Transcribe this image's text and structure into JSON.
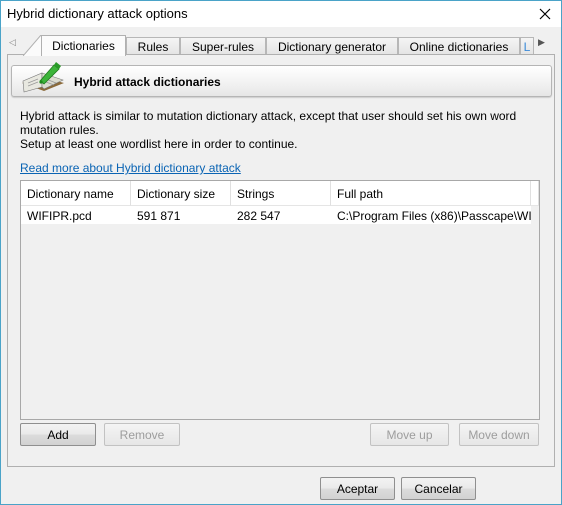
{
  "window": {
    "title": "Hybrid dictionary attack options",
    "close_icon": "close-icon"
  },
  "tabs": [
    {
      "label": "Dictionaries",
      "active": true
    },
    {
      "label": "Rules",
      "active": false
    },
    {
      "label": "Super-rules",
      "active": false
    },
    {
      "label": "Dictionary generator",
      "active": false
    },
    {
      "label": "Online dictionaries",
      "active": false
    },
    {
      "label": "L",
      "active": false
    }
  ],
  "tab_scroll": {
    "left": "◁",
    "right": "▶"
  },
  "header": {
    "title": "Hybrid attack dictionaries",
    "icon": "dictionary-book-icon"
  },
  "description": {
    "line1": "Hybrid attack is similar to mutation dictionary attack, except that user should set his own word mutation rules.",
    "line2": "Setup at least one wordlist here in order to continue."
  },
  "link": "Read more about Hybrid dictionary attack",
  "table": {
    "columns": [
      "Dictionary name",
      "Dictionary size",
      "Strings",
      "Full path"
    ],
    "rows": [
      [
        "WIFIPR.pcd",
        "591 871",
        "282 547",
        "C:\\Program Files (x86)\\Passcape\\WI..."
      ]
    ]
  },
  "buttons": {
    "add": "Add",
    "remove": "Remove",
    "move_up": "Move up",
    "move_down": "Move down",
    "ok": "Aceptar",
    "cancel": "Cancelar"
  }
}
